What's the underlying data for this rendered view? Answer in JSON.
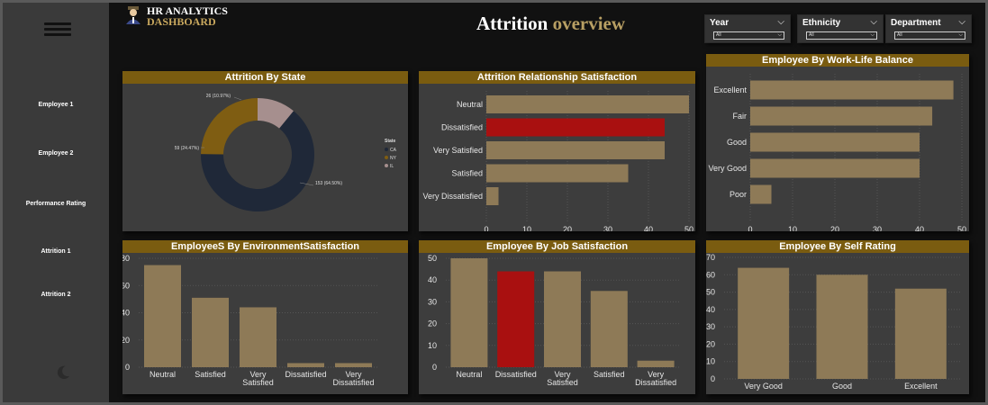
{
  "app": {
    "brand_line1": "HR ANALYTICS",
    "brand_line2": "DASHBOARD",
    "title_main": "Attrition",
    "title_accent": "overview"
  },
  "sidebar": {
    "items": [
      "Employee 1",
      "Employee 2",
      "Performance Rating",
      "Attrition 1",
      "Attrition 2"
    ]
  },
  "filters": [
    {
      "label": "Year",
      "value": "All"
    },
    {
      "label": "Ethnicity",
      "value": "All"
    },
    {
      "label": "Department",
      "value": "All"
    }
  ],
  "colors": {
    "bar": "#8e7a57",
    "highlight": "#a91010",
    "header": "#7a5c10",
    "donut_ca": "#1f2838",
    "donut_ny": "#7f5d12",
    "donut_il": "#a68f8e"
  },
  "charts": {
    "state": {
      "title": "Attrition By State",
      "legend_title": "State",
      "chart_data": {
        "type": "pie",
        "categories": [
          "CA",
          "NY",
          "IL"
        ],
        "values": [
          153,
          59,
          26
        ],
        "data_labels": [
          "153 (64.50%)",
          "59 (24.47%)",
          "26 (10.97%)"
        ]
      }
    },
    "relationship": {
      "title": "Attrition Relationship Satisfaction",
      "chart_data": {
        "type": "bar",
        "orientation": "horizontal",
        "categories": [
          "Neutral",
          "Dissatisfied",
          "Very Satisfied",
          "Satisfied",
          "Very Dissatisfied"
        ],
        "values": [
          50,
          44,
          44,
          35,
          3
        ],
        "highlight": [
          false,
          true,
          false,
          false,
          false
        ],
        "xlim": [
          0,
          50
        ],
        "ticks": [
          "0",
          "10",
          "20",
          "30",
          "40",
          "50"
        ]
      }
    },
    "worklife": {
      "title": "Employee By Work-Life Balance",
      "chart_data": {
        "type": "bar",
        "orientation": "horizontal",
        "categories": [
          "Excellent",
          "Fair",
          "Good",
          "Very Good",
          "Poor"
        ],
        "values": [
          48,
          43,
          40,
          40,
          5
        ],
        "highlight": [
          false,
          false,
          false,
          false,
          false
        ],
        "xlim": [
          0,
          50
        ],
        "ticks": [
          "0",
          "10",
          "20",
          "30",
          "40",
          "50"
        ]
      }
    },
    "environment": {
      "title": "EmployeeS By EnvironmentSatisfaction",
      "chart_data": {
        "type": "bar",
        "orientation": "vertical",
        "categories": [
          "Neutral",
          "Satisfied",
          "Very Satisfied",
          "Dissatisfied",
          "Very Dissatisfied"
        ],
        "values": [
          75,
          51,
          44,
          3,
          3
        ],
        "highlight": [
          false,
          false,
          false,
          false,
          false
        ],
        "ylim": [
          0,
          80
        ],
        "ticks": [
          "0",
          "20",
          "40",
          "60",
          "80"
        ]
      }
    },
    "job": {
      "title": "Employee By Job Satisfaction",
      "chart_data": {
        "type": "bar",
        "orientation": "vertical",
        "categories": [
          "Neutral",
          "Dissatisfied",
          "Very Satisfied",
          "Satisfied",
          "Very Dissatisfied"
        ],
        "values": [
          50,
          44,
          44,
          35,
          3
        ],
        "highlight": [
          false,
          true,
          false,
          false,
          false
        ],
        "ylim": [
          0,
          50
        ],
        "ticks": [
          "0",
          "10",
          "20",
          "30",
          "40",
          "50"
        ]
      }
    },
    "selfrating": {
      "title": "Employee By Self Rating",
      "chart_data": {
        "type": "bar",
        "orientation": "vertical",
        "categories": [
          "Very Good",
          "Good",
          "Excellent"
        ],
        "values": [
          64,
          60,
          52
        ],
        "highlight": [
          false,
          false,
          false
        ],
        "ylim": [
          0,
          70
        ],
        "ticks": [
          "0",
          "10",
          "20",
          "30",
          "40",
          "50",
          "60",
          "70"
        ]
      }
    }
  }
}
